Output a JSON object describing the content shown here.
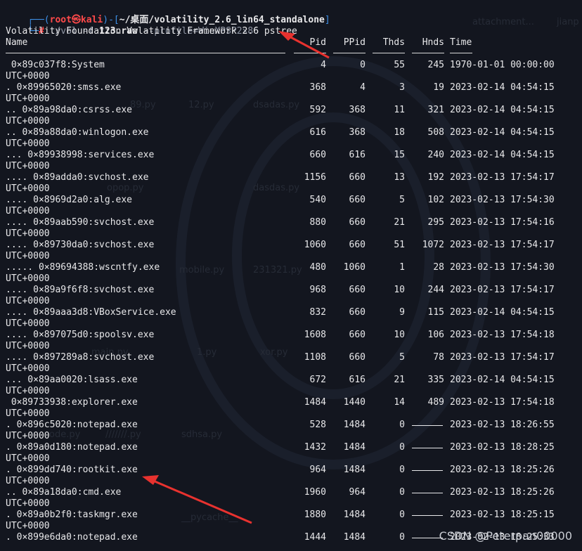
{
  "prompt": {
    "user": "root",
    "host": "kali",
    "symbol": "㉿",
    "path": "~/桌面/volatility_2.6_lin64_standalone",
    "cmd_prefix": "./vol",
    "flag1": "-f",
    "file": "123.raw",
    "flag2": "--profile=WinXPSP2×86",
    "plugin": "pstree"
  },
  "banner": "Volatility Foundation Volatility Framework 2.6",
  "columns": [
    "Name",
    "Pid",
    "PPid",
    "Thds",
    "Hnds",
    "Time"
  ],
  "rows": [
    {
      "name": " 0×89c037f8:System",
      "pid": "4",
      "ppid": "0",
      "thds": "55",
      "hnds": "245",
      "time": "1970-01-01 00:00:00",
      "tz": "UTC+0000"
    },
    {
      "name": ". 0×89965020:smss.exe",
      "pid": "368",
      "ppid": "4",
      "thds": "3",
      "hnds": "19",
      "time": "2023-02-14 04:54:15",
      "tz": "UTC+0000"
    },
    {
      "name": ".. 0×89a98da0:csrss.exe",
      "pid": "592",
      "ppid": "368",
      "thds": "11",
      "hnds": "321",
      "time": "2023-02-14 04:54:15",
      "tz": "UTC+0000"
    },
    {
      "name": ".. 0×89a88da0:winlogon.exe",
      "pid": "616",
      "ppid": "368",
      "thds": "18",
      "hnds": "508",
      "time": "2023-02-14 04:54:15",
      "tz": "UTC+0000"
    },
    {
      "name": "... 0×89938998:services.exe",
      "pid": "660",
      "ppid": "616",
      "thds": "15",
      "hnds": "240",
      "time": "2023-02-14 04:54:15",
      "tz": "UTC+0000"
    },
    {
      "name": ".... 0×89adda0:svchost.exe",
      "pid": "1156",
      "ppid": "660",
      "thds": "13",
      "hnds": "192",
      "time": "2023-02-13 17:54:17",
      "tz": "UTC+0000"
    },
    {
      "name": ".... 0×8969d2a0:alg.exe",
      "pid": "540",
      "ppid": "660",
      "thds": "5",
      "hnds": "102",
      "time": "2023-02-13 17:54:30",
      "tz": "UTC+0000"
    },
    {
      "name": ".... 0×89aab590:svchost.exe",
      "pid": "880",
      "ppid": "660",
      "thds": "21",
      "hnds": "295",
      "time": "2023-02-13 17:54:16",
      "tz": "UTC+0000"
    },
    {
      "name": ".... 0×89730da0:svchost.exe",
      "pid": "1060",
      "ppid": "660",
      "thds": "51",
      "hnds": "1072",
      "time": "2023-02-13 17:54:17",
      "tz": "UTC+0000"
    },
    {
      "name": "..... 0×89694388:wscntfy.exe",
      "pid": "480",
      "ppid": "1060",
      "thds": "1",
      "hnds": "28",
      "time": "2023-02-13 17:54:30",
      "tz": "UTC+0000"
    },
    {
      "name": ".... 0×89a9f6f8:svchost.exe",
      "pid": "968",
      "ppid": "660",
      "thds": "10",
      "hnds": "244",
      "time": "2023-02-13 17:54:17",
      "tz": "UTC+0000"
    },
    {
      "name": ".... 0×89aaa3d8:VBoxService.exe",
      "pid": "832",
      "ppid": "660",
      "thds": "9",
      "hnds": "115",
      "time": "2023-02-14 04:54:15",
      "tz": "UTC+0000"
    },
    {
      "name": ".... 0×897075d0:spoolsv.exe",
      "pid": "1608",
      "ppid": "660",
      "thds": "10",
      "hnds": "106",
      "time": "2023-02-13 17:54:18",
      "tz": "UTC+0000"
    },
    {
      "name": ".... 0×897289a8:svchost.exe",
      "pid": "1108",
      "ppid": "660",
      "thds": "5",
      "hnds": "78",
      "time": "2023-02-13 17:54:17",
      "tz": "UTC+0000"
    },
    {
      "name": "... 0×89aa0020:lsass.exe",
      "pid": "672",
      "ppid": "616",
      "thds": "21",
      "hnds": "335",
      "time": "2023-02-14 04:54:15",
      "tz": "UTC+0000"
    },
    {
      "name": " 0×89733938:explorer.exe",
      "pid": "1484",
      "ppid": "1440",
      "thds": "14",
      "hnds": "489",
      "time": "2023-02-13 17:54:18",
      "tz": "UTC+0000"
    },
    {
      "name": ". 0×896c5020:notepad.exe",
      "pid": "528",
      "ppid": "1484",
      "thds": "0",
      "hnds": "",
      "time": "2023-02-13 18:26:55",
      "tz": "UTC+0000"
    },
    {
      "name": ". 0×89a0d180:notepad.exe",
      "pid": "1432",
      "ppid": "1484",
      "thds": "0",
      "hnds": "",
      "time": "2023-02-13 18:28:25",
      "tz": "UTC+0000"
    },
    {
      "name": ". 0×899dd740:rootkit.exe",
      "pid": "964",
      "ppid": "1484",
      "thds": "0",
      "hnds": "",
      "time": "2023-02-13 18:25:26",
      "tz": "UTC+0000"
    },
    {
      "name": ".. 0×89a18da0:cmd.exe",
      "pid": "1960",
      "ppid": "964",
      "thds": "0",
      "hnds": "",
      "time": "2023-02-13 18:25:26",
      "tz": "UTC+0000"
    },
    {
      "name": ". 0×89a0b2f0:taskmgr.exe",
      "pid": "1880",
      "ppid": "1484",
      "thds": "0",
      "hnds": "",
      "time": "2023-02-13 18:25:15",
      "tz": "UTC+0000"
    },
    {
      "name": ". 0×899e6da0:notepad.exe",
      "pid": "1444",
      "ppid": "1484",
      "thds": "0",
      "hnds": "",
      "time": "2023-02-13 18:25:33",
      "tz": ""
    }
  ],
  "watermark": "CSDN @Peterpan00000",
  "background_labels": [
    "attachment...",
    "jianp",
    "12.py",
    "dsadas.py",
    "89.py",
    "dasdas.py",
    "opop.py",
    "mobile.py",
    "231321.py",
    "1.py",
    "xor.py",
    "///////.py",
    "sdhsa.py",
    "__pycache__",
    "ode.py",
    "main.py"
  ],
  "colors": {
    "background": "#13161f",
    "prompt_blue": "#3d8fe6",
    "prompt_red": "#ff4a4a",
    "arrow": "#e8322f"
  }
}
